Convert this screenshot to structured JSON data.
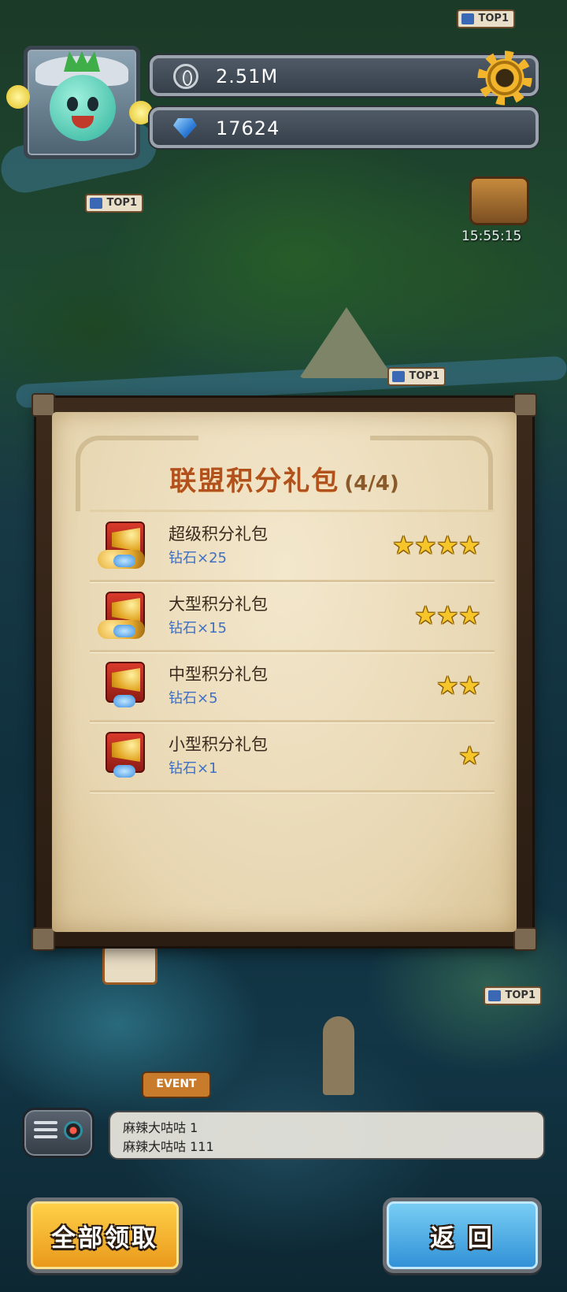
{
  "header": {
    "coins_value": "2.51M",
    "gems_value": "17624",
    "coin_icon": "coin-icon",
    "gem_icon": "diamond-icon",
    "settings_icon": "gear-icon"
  },
  "map": {
    "timer": "15:55:15",
    "badge_label": "TOP1",
    "event_label": "EVENT"
  },
  "panel": {
    "title": "联盟积分礼包",
    "count": "(4/4)",
    "items": [
      {
        "name": "超级积分礼包",
        "reward": "钻石×25",
        "stars": 4
      },
      {
        "name": "大型积分礼包",
        "reward": "钻石×15",
        "stars": 3
      },
      {
        "name": "中型积分礼包",
        "reward": "钻石×5",
        "stars": 2
      },
      {
        "name": "小型积分礼包",
        "reward": "钻石×1",
        "stars": 1
      }
    ]
  },
  "chat": {
    "lines": [
      "麻辣大咕咕 1",
      "麻辣大咕咕 111"
    ]
  },
  "buttons": {
    "claim_all": "全部领取",
    "back": "返 回"
  },
  "colors": {
    "title": "#b3511c",
    "reward_text": "#3f6fc2",
    "star": "#f5c52a",
    "claim_button": "#f3b632",
    "back_button": "#4aa8e4"
  }
}
